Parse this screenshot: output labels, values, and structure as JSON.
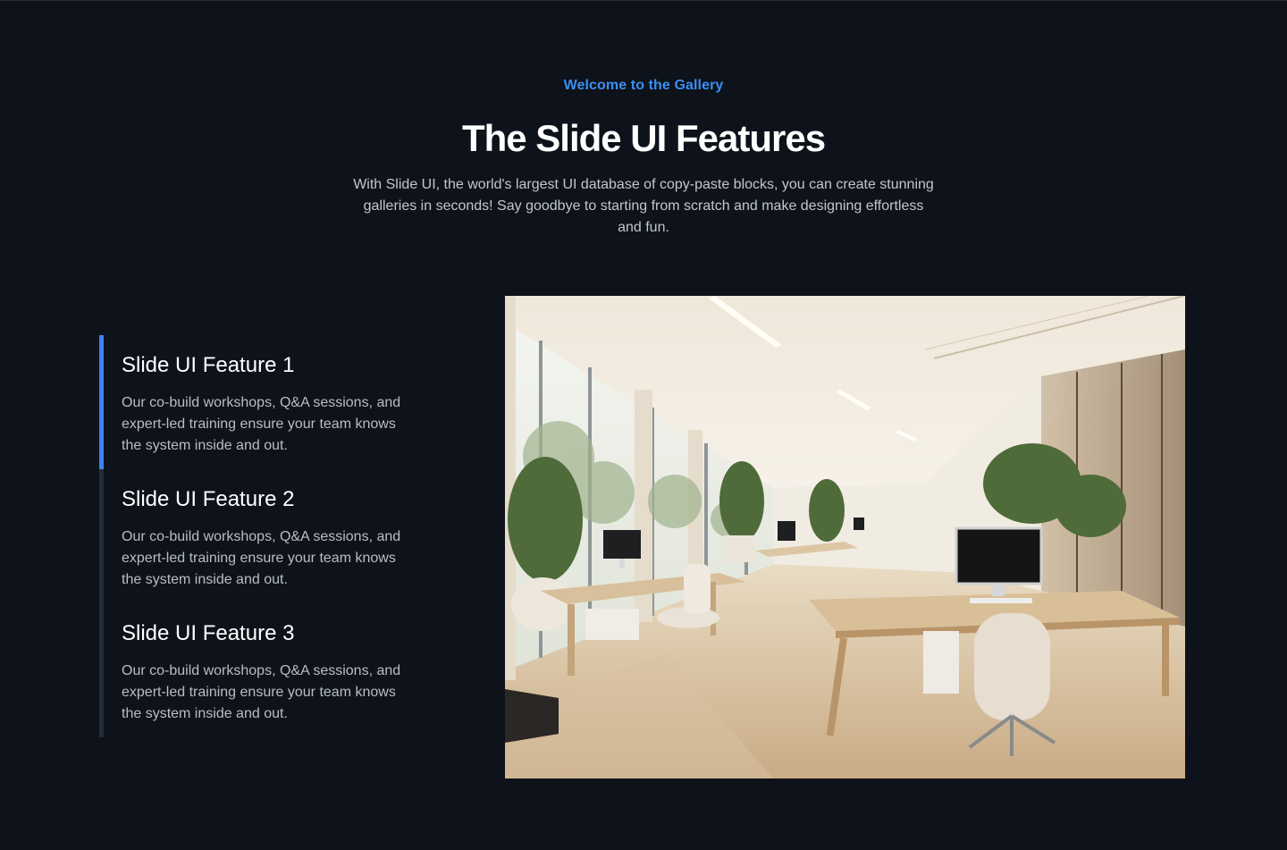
{
  "header": {
    "eyebrow": "Welcome to the Gallery",
    "title": "The Slide UI Features",
    "subtitle": "With Slide UI, the world's largest UI database of copy-paste blocks, you can create stunning galleries in seconds! Say goodbye to starting from scratch and make designing effortless and fun."
  },
  "features": [
    {
      "title": "Slide UI Feature 1",
      "description": "Our co-build workshops, Q&A sessions, and expert-led training ensure your team knows the system inside and out.",
      "active": true
    },
    {
      "title": "Slide UI Feature 2",
      "description": "Our co-build workshops, Q&A sessions, and expert-led training ensure your team knows the system inside and out.",
      "active": false
    },
    {
      "title": "Slide UI Feature 3",
      "description": "Our co-build workshops, Q&A sessions, and expert-led training ensure your team knows the system inside and out.",
      "active": false
    }
  ],
  "colors": {
    "background": "#0d121b",
    "accent": "#3b82f6",
    "eyebrow": "#3b8ff0",
    "inactive_bar": "#252b36"
  }
}
